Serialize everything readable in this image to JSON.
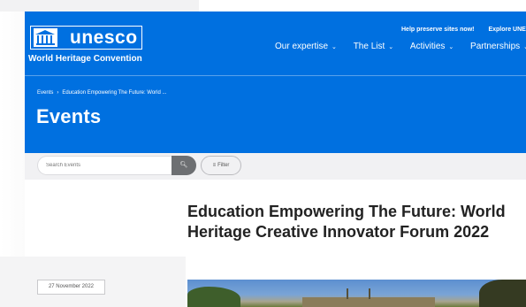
{
  "header": {
    "logo_text": "unesco",
    "org_name": "World Heritage Convention",
    "util_links": [
      "Help preserve sites now!",
      "Explore UNE"
    ],
    "nav": [
      {
        "label": "Our expertise"
      },
      {
        "label": "The List"
      },
      {
        "label": "Activities"
      },
      {
        "label": "Partnerships"
      }
    ],
    "breadcrumb": [
      "Events",
      "Education Empowering The Future: World ..."
    ],
    "breadcrumb_separator": "›",
    "page_title": "Events",
    "colors": {
      "header_bg": "#0070e0",
      "text": "#ffffff"
    }
  },
  "search": {
    "placeholder": "Search Events",
    "button_icon": "search-icon",
    "filter_label": "Filter",
    "filter_icon": "filter-icon"
  },
  "event": {
    "title": "Education Empowering The Future: World Heritage Creative Innovator Forum 2022",
    "date": "27 November 2022"
  }
}
